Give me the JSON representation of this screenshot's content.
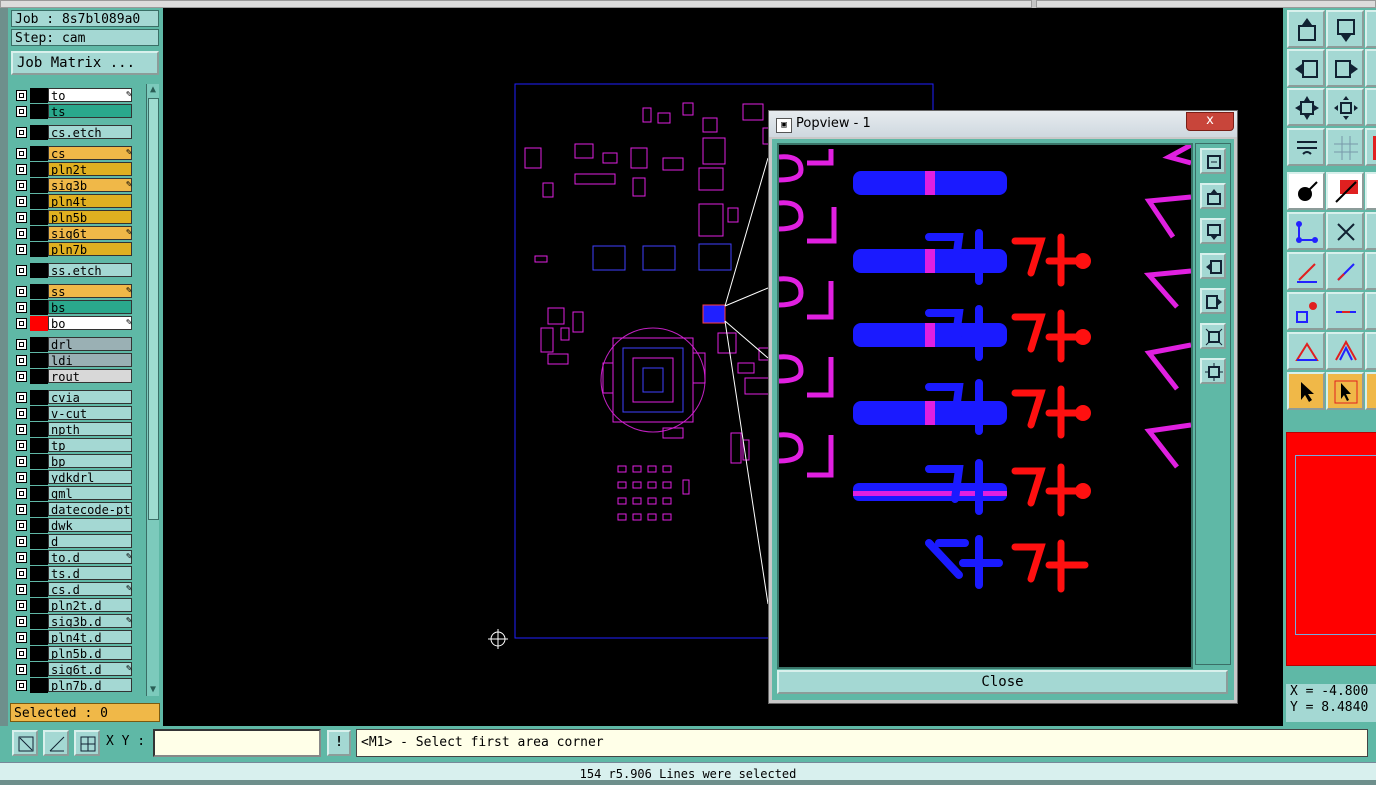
{
  "job": {
    "job_label": "Job : 8s7bl089a0",
    "step_label": "Step: cam",
    "matrix_button": "Job Matrix ..."
  },
  "layers": [
    {
      "name": "to",
      "color": "#ffffff",
      "locked": true
    },
    {
      "name": "ts",
      "color": "#2aa88c",
      "locked": false
    },
    {
      "name": "cs.etch",
      "color": "#a4d8d3",
      "locked": false
    },
    {
      "name": "cs",
      "color": "#f0b848",
      "locked": true
    },
    {
      "name": "pln2t",
      "color": "#e0b020",
      "locked": false
    },
    {
      "name": "sig3b",
      "color": "#f0b848",
      "locked": true
    },
    {
      "name": "pln4t",
      "color": "#e0b020",
      "locked": false
    },
    {
      "name": "pln5b",
      "color": "#e0b020",
      "locked": false
    },
    {
      "name": "sig6t",
      "color": "#f0b848",
      "locked": true
    },
    {
      "name": "pln7b",
      "color": "#e0b020",
      "locked": false
    },
    {
      "name": "ss.etch",
      "color": "#a4d8d3",
      "locked": false
    },
    {
      "name": "ss",
      "color": "#f0b848",
      "locked": true
    },
    {
      "name": "bs",
      "color": "#2aa88c",
      "locked": false
    },
    {
      "name": "bo",
      "color": "#ffffff",
      "locked": true,
      "swatch": "#ff0000"
    },
    {
      "name": "drl",
      "color": "#9ab0b4",
      "locked": false
    },
    {
      "name": "ldi",
      "color": "#9ab0b4",
      "locked": false
    },
    {
      "name": "rout",
      "color": "#d8d8d8",
      "locked": false
    },
    {
      "name": "cvia",
      "color": "#a4d8d3",
      "locked": false
    },
    {
      "name": "v-cut",
      "color": "#a4d8d3",
      "locked": false
    },
    {
      "name": "npth",
      "color": "#a4d8d3",
      "locked": false
    },
    {
      "name": "tp",
      "color": "#a4d8d3",
      "locked": false
    },
    {
      "name": "bp",
      "color": "#a4d8d3",
      "locked": false
    },
    {
      "name": "ydkdrl",
      "color": "#a4d8d3",
      "locked": false
    },
    {
      "name": "gml",
      "color": "#a4d8d3",
      "locked": false
    },
    {
      "name": "datecode-ptc",
      "color": "#a4d8d3",
      "locked": false
    },
    {
      "name": "dwk",
      "color": "#a4d8d3",
      "locked": false
    },
    {
      "name": "d",
      "color": "#a4d8d3",
      "locked": false
    },
    {
      "name": "to.d",
      "color": "#a4d8d3",
      "locked": true
    },
    {
      "name": "ts.d",
      "color": "#a4d8d3",
      "locked": false
    },
    {
      "name": "cs.d",
      "color": "#a4d8d3",
      "locked": true
    },
    {
      "name": "pln2t.d",
      "color": "#a4d8d3",
      "locked": false
    },
    {
      "name": "sig3b.d",
      "color": "#a4d8d3",
      "locked": true
    },
    {
      "name": "pln4t.d",
      "color": "#a4d8d3",
      "locked": false
    },
    {
      "name": "pln5b.d",
      "color": "#a4d8d3",
      "locked": false
    },
    {
      "name": "sig6t.d",
      "color": "#a4d8d3",
      "locked": true
    },
    {
      "name": "pln7b.d",
      "color": "#a4d8d3",
      "locked": false
    }
  ],
  "selected_label": "Selected : 0",
  "popview": {
    "title": "Popview - 1",
    "close_x": "x",
    "close_button": "Close"
  },
  "coords": {
    "x_text": "X = -4.800",
    "y_text": "Y = 8.4840"
  },
  "command": {
    "xy_label": "X Y :",
    "xy_value": "",
    "bang_label": "!",
    "prompt": "<M1> - Select first area corner"
  },
  "status": "154 r5.906 Lines were selected",
  "colors": {
    "panel": "#5fb8a6",
    "blue_feature": "#1a1aff",
    "magenta_feature": "#e020e0",
    "red_feature": "#ff1010",
    "highlight": "#f0b848"
  },
  "icons": {
    "lock": "pencil-lock-icon",
    "cursor": "crosshair-icon"
  }
}
